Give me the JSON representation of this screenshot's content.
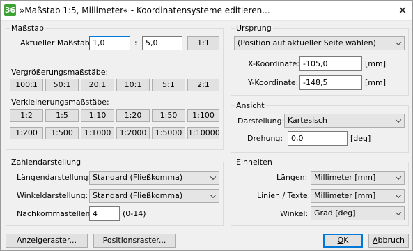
{
  "window": {
    "title": "»Maßstab 1:5, Millimeter« - Koordinatensysteme editieren...",
    "app_icon_text": "36",
    "close_symbol": "✕"
  },
  "massstab": {
    "group_label": "Maßstab",
    "aktuell_label": "Aktueller Maßstab:",
    "value1": "1,0",
    "colon": ":",
    "value2": "5,0",
    "ratio_button": "1:1",
    "vergroesserung_label": "Vergrößerungsmaßstäbe:",
    "vergroesserung": [
      "100:1",
      "50:1",
      "20:1",
      "10:1",
      "5:1",
      "2:1"
    ],
    "verkleinerung_label": "Verkleinerungsmaßstäbe:",
    "verkleinerung_row1": [
      "1:2",
      "1:5",
      "1:10",
      "1:20",
      "1:50",
      "1:100"
    ],
    "verkleinerung_row2": [
      "1:200",
      "1:500",
      "1:1000",
      "1:2000",
      "1:5000",
      "1:10000"
    ]
  },
  "ursprung": {
    "group_label": "Ursprung",
    "combo_value": "(Position auf aktueller Seite wählen)",
    "x_label": "X-Koordinate:",
    "x_value": "-105,0",
    "x_unit": "[mm]",
    "y_label": "Y-Koordinate:",
    "y_value": "-148,5",
    "y_unit": "[mm]"
  },
  "ansicht": {
    "group_label": "Ansicht",
    "darstellung_label": "Darstellung:",
    "darstellung_value": "Kartesisch",
    "drehung_label": "Drehung:",
    "drehung_value": "0,0",
    "drehung_unit": "[deg]"
  },
  "zahlen": {
    "group_label": "Zahlendarstellung",
    "laengen_label": "Längendarstellung:",
    "laengen_value": "Standard (Fließkomma)",
    "winkel_label": "Winkeldarstellung:",
    "winkel_value": "Standard (Fließkomma)",
    "nachkomma_label": "Nachkommastellen:",
    "nachkomma_value": "4",
    "nachkomma_range": "(0-14)"
  },
  "einheiten": {
    "group_label": "Einheiten",
    "laengen_label": "Längen:",
    "laengen_value": "Millimeter [mm]",
    "linien_label": "Linien / Texte:",
    "linien_value": "Millimeter [mm]",
    "winkel_label": "Winkel:",
    "winkel_value": "Grad [deg]"
  },
  "footer": {
    "anzeigeraster": "Anzeigeraster...",
    "positionsraster": "Positionsraster...",
    "ok_u": "O",
    "ok_rest": "K",
    "abbruch_u": "A",
    "abbruch_rest": "bbruch"
  }
}
